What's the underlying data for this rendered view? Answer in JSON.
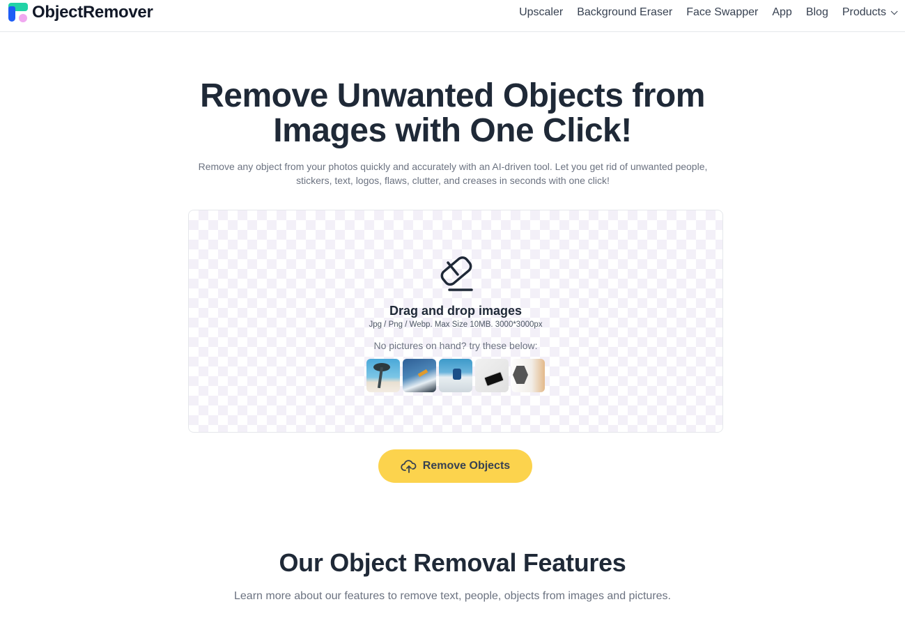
{
  "header": {
    "logo_text": "ObjectRemover",
    "nav": [
      {
        "label": "Upscaler"
      },
      {
        "label": "Background Eraser"
      },
      {
        "label": "Face Swapper"
      },
      {
        "label": "App"
      },
      {
        "label": "Blog"
      },
      {
        "label": "Products",
        "has_dropdown": true
      }
    ]
  },
  "hero": {
    "title_line1": "Remove Unwanted Objects from",
    "title_line2": "Images with One Click!",
    "subtitle": "Remove any object from your photos quickly and accurately with an AI-driven tool. Let you get rid of unwanted people, stickers, text, logos, flaws, clutter, and creases in seconds with one click!"
  },
  "dropzone": {
    "icon": "eraser-icon",
    "title": "Drag and drop images",
    "hint": "Jpg / Png / Webp. Max Size 10MB. 3000*3000px",
    "try_label": "No pictures on hand? try these below:",
    "samples": [
      {
        "name": "beach-palm-sample"
      },
      {
        "name": "surfer-sample"
      },
      {
        "name": "skier-sample"
      },
      {
        "name": "desk-phone-sample"
      },
      {
        "name": "poster-person-sample"
      }
    ]
  },
  "action": {
    "button_label": "Remove Objects",
    "button_icon": "cloud-upload-icon",
    "button_color": "#fcd34d"
  },
  "features": {
    "title": "Our Object Removal Features",
    "subtitle": "Learn more about our features to remove text, people, objects from images and pictures."
  }
}
